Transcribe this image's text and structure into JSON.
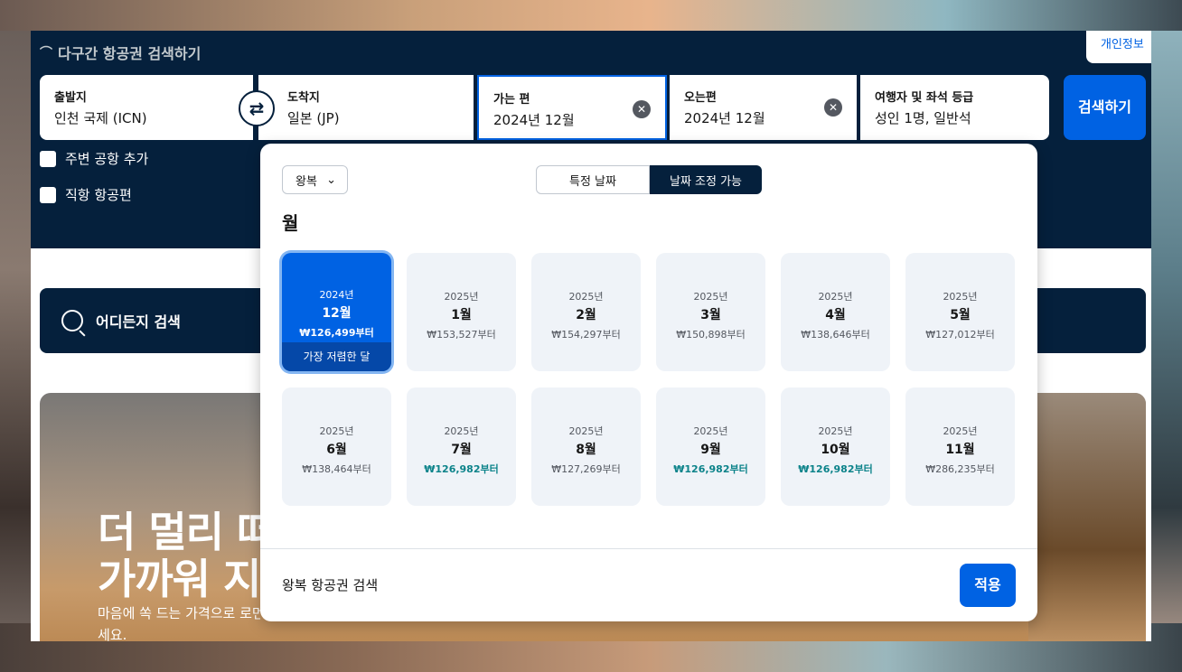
{
  "header": {
    "title": "다구간 항공권 검색하기",
    "privacy_link": "개인정보"
  },
  "search": {
    "from": {
      "label": "출발지",
      "value": "인천 국제 (ICN)"
    },
    "to": {
      "label": "도착지",
      "value": "일본 (JP)"
    },
    "depart": {
      "label": "가는 편",
      "value": "2024년 12월"
    },
    "return": {
      "label": "오는편",
      "value": "2024년 12월"
    },
    "travellers": {
      "label": "여행자 및 좌석 등급",
      "value": "성인 1명, 일반석"
    },
    "search_button": "검색하기",
    "nearby_airports": "주변 공항 추가",
    "direct_flights": "직항 항공편"
  },
  "anywhere": {
    "label": "어디든지 검색"
  },
  "promo": {
    "title_line1": "더 멀리 떠",
    "title_line2": "가까워 지",
    "sub_line1": "마음에 쏙 드는 가격으로 로먼",
    "sub_line2": "세요."
  },
  "popup": {
    "trip_type": "왕복",
    "seg_specific": "특정 날짜",
    "seg_flexible": "날짜 조정 가능",
    "heading": "월",
    "months": [
      {
        "year": "2024년",
        "month": "12월",
        "price": "₩126,499부터",
        "tag": "가장 저렴한 달"
      },
      {
        "year": "2025년",
        "month": "1월",
        "price": "₩153,527부터"
      },
      {
        "year": "2025년",
        "month": "2월",
        "price": "₩154,297부터"
      },
      {
        "year": "2025년",
        "month": "3월",
        "price": "₩150,898부터"
      },
      {
        "year": "2025년",
        "month": "4월",
        "price": "₩138,646부터"
      },
      {
        "year": "2025년",
        "month": "5월",
        "price": "₩127,012부터"
      },
      {
        "year": "2025년",
        "month": "6월",
        "price": "₩138,464부터"
      },
      {
        "year": "2025년",
        "month": "7월",
        "price": "₩126,982부터"
      },
      {
        "year": "2025년",
        "month": "8월",
        "price": "₩127,269부터"
      },
      {
        "year": "2025년",
        "month": "9월",
        "price": "₩126,982부터"
      },
      {
        "year": "2025년",
        "month": "10월",
        "price": "₩126,982부터"
      },
      {
        "year": "2025년",
        "month": "11월",
        "price": "₩286,235부터"
      }
    ],
    "footer_text": "왕복 항공권 검색",
    "apply_button": "적용"
  },
  "colors": {
    "brand_dark": "#05203c",
    "accent_blue": "#0062e3",
    "good_price": "#0c838a"
  }
}
